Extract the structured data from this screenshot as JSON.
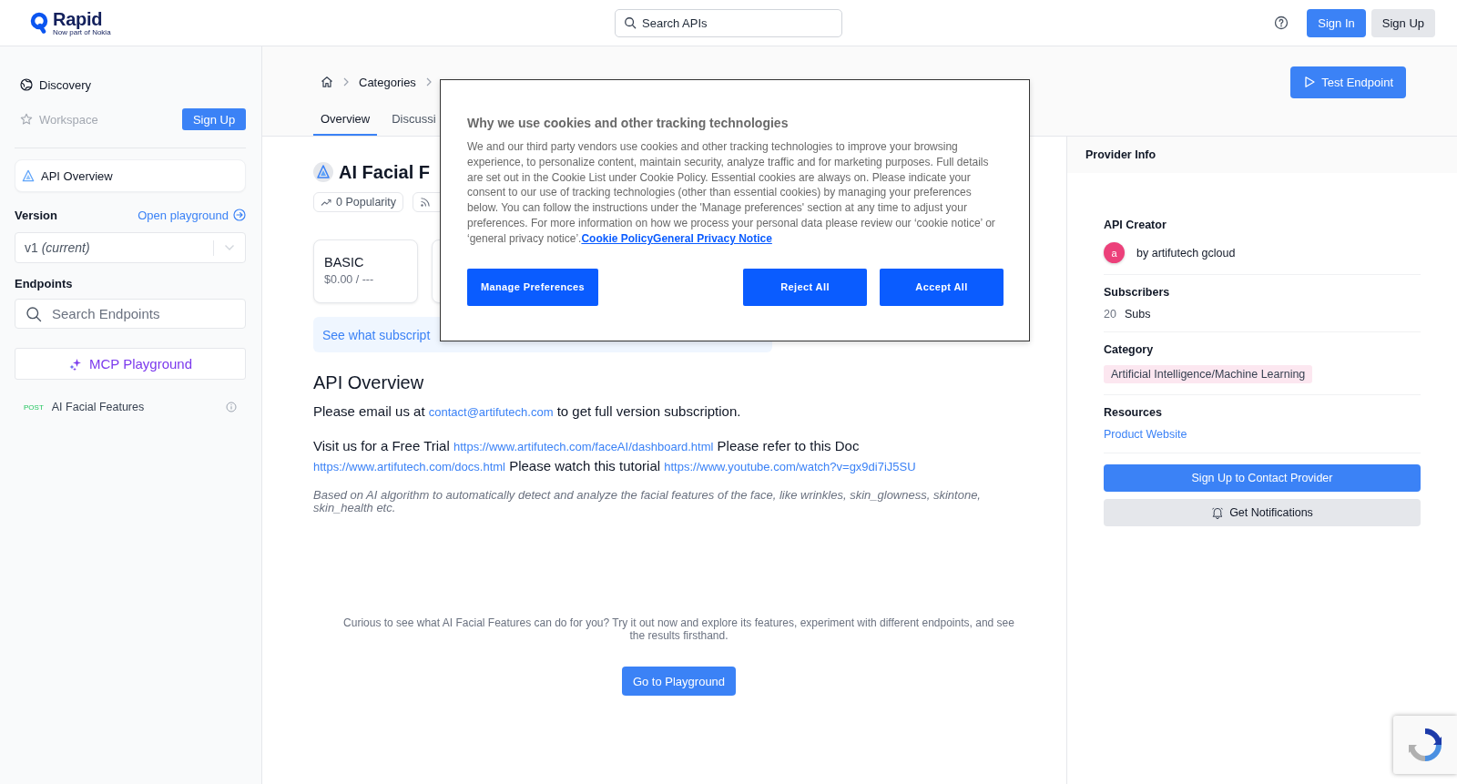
{
  "header": {
    "logo": {
      "name": "Rapid",
      "tagline": "Now part of Nokia"
    },
    "search": {
      "placeholder": "Search APIs"
    },
    "buttons": [
      {
        "label": "Sign In",
        "kind": "primary"
      },
      {
        "label": "Sign Up",
        "kind": "secondary"
      }
    ]
  },
  "sidebar": {
    "discovery": {
      "label": "Discovery",
      "disabled": false
    },
    "workspace": {
      "label": "Workspace",
      "disabled": true
    },
    "sign_up_button": "Sign Up",
    "api_overview": {
      "label": "API Overview",
      "selected": true
    },
    "version": {
      "label": "Version",
      "link": "Open playground",
      "value": "v1 *(current)*"
    },
    "endpoints": {
      "label": "Endpoints",
      "search_placeholder": "Search Endpoints",
      "mcp_button": "MCP Playground",
      "items": [
        {
          "method": "POST",
          "name": "AI Facial Features"
        }
      ]
    }
  },
  "main": {
    "breadcrumb": [
      "Categories"
    ],
    "tabs": [
      {
        "label": "Overview",
        "selected": true
      },
      {
        "label": "Discussi",
        "selected": false
      }
    ],
    "test_button": "Test Endpoint",
    "title": "AI Facial F",
    "stats": [
      {
        "kind": "trend",
        "text": "0 Popularity"
      },
      {
        "kind": "feed"
      }
    ],
    "plans": [
      {
        "name": "BASIC",
        "price": "$0.00 / ---"
      }
    ],
    "banner": "See what subscript",
    "overview": {
      "heading": "API Overview",
      "paragraphs": [
        [
          {
            "kind": "text",
            "text": "Please email us at "
          },
          {
            "kind": "link",
            "text": "contact@artifutech.com"
          },
          {
            "kind": "text",
            "text": " to get full version subscription."
          }
        ],
        [
          {
            "kind": "text",
            "text": "Visit us for a Free Trial "
          },
          {
            "kind": "link",
            "text": "https://www.artifutech.com/faceAI/dashboard.html"
          },
          {
            "kind": "text",
            "text": " Please refer to this Doc "
          },
          {
            "kind": "link",
            "text": "https://www.artifutech.com/docs.html"
          },
          {
            "kind": "text",
            "text": " Please watch this tutorial "
          },
          {
            "kind": "link",
            "text": "https://www.youtube.com/watch?v=gx9di7iJ5SU"
          }
        ]
      ],
      "description": "Based on AI algorithm to automatically detect and analyze the facial features of the face, like wrinkles, skin_glowness, skintone, skin_health etc."
    },
    "cta": {
      "text": "Curious to see what AI Facial Features can do for you? Try it out now and explore its features, experiment with different endpoints, and see the results firsthand.",
      "button": "Go to Playground"
    }
  },
  "provider_info": {
    "title": "Provider Info",
    "creator": {
      "label": "API Creator",
      "avatar": "a",
      "name": "by artifutech gcloud"
    },
    "subscribers": {
      "label": "Subscribers",
      "count": "20",
      "unit": "Subs"
    },
    "category": {
      "label": "Category",
      "tag": "Artificial Intelligence/Machine Learning"
    },
    "resources": {
      "label": "Resources",
      "link": "Product Website"
    },
    "buttons": [
      {
        "label": "Sign Up to Contact Provider",
        "kind": "primary"
      },
      {
        "label": "Get Notifications",
        "kind": "secondary"
      }
    ]
  },
  "cookie_dialog": {
    "title": "Why we use cookies and other tracking technologies",
    "body": "We and our third party vendors use cookies and other tracking technologies to improve your browsing experience, to personalize content, maintain security, analyze traffic and for marketing purposes. Full details are set out in the Cookie List under Cookie Policy. Essential cookies are always on. Please indicate your consent to our use of tracking technologies (other than essential cookies) by managing your preferences below. You can follow the instructions under the 'Manage preferences' section at any time to adjust your preferences. For more information on how we process your personal data please review our ‘cookie notice’ or ‘general privacy notice’.",
    "links": [
      "Cookie Policy",
      "General Privacy Notice"
    ],
    "buttons": [
      {
        "label": "Manage Preferences",
        "kind": "left"
      },
      {
        "label": "Reject All",
        "kind": "right"
      },
      {
        "label": "Accept All",
        "kind": "right"
      }
    ]
  }
}
